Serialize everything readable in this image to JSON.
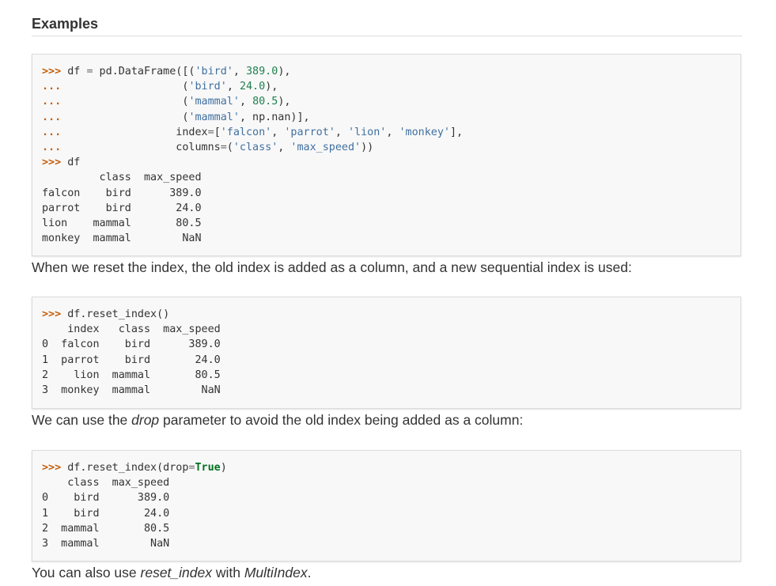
{
  "heading": "Examples",
  "block1": {
    "lines": [
      [
        [
          "prompt",
          ">>>"
        ],
        [
          "",
          " df "
        ],
        [
          "op",
          "="
        ],
        [
          "",
          " pd.DataFrame([("
        ],
        [
          "str",
          "'bird'"
        ],
        [
          "",
          ", "
        ],
        [
          "num",
          "389.0"
        ],
        [
          "",
          "),"
        ]
      ],
      [
        [
          "prompt",
          "..."
        ],
        [
          "",
          "                   ("
        ],
        [
          "str",
          "'bird'"
        ],
        [
          "",
          ", "
        ],
        [
          "num",
          "24.0"
        ],
        [
          "",
          "),"
        ]
      ],
      [
        [
          "prompt",
          "..."
        ],
        [
          "",
          "                   ("
        ],
        [
          "str",
          "'mammal'"
        ],
        [
          "",
          ", "
        ],
        [
          "num",
          "80.5"
        ],
        [
          "",
          "),"
        ]
      ],
      [
        [
          "prompt",
          "..."
        ],
        [
          "",
          "                   ("
        ],
        [
          "str",
          "'mammal'"
        ],
        [
          "",
          ", np.nan)],"
        ]
      ],
      [
        [
          "prompt",
          "..."
        ],
        [
          "",
          "                  index"
        ],
        [
          "op",
          "="
        ],
        [
          "",
          "["
        ],
        [
          "str",
          "'falcon'"
        ],
        [
          "",
          ", "
        ],
        [
          "str",
          "'parrot'"
        ],
        [
          "",
          ", "
        ],
        [
          "str",
          "'lion'"
        ],
        [
          "",
          ", "
        ],
        [
          "str",
          "'monkey'"
        ],
        [
          "",
          "],"
        ]
      ],
      [
        [
          "prompt",
          "..."
        ],
        [
          "",
          "                  columns"
        ],
        [
          "op",
          "="
        ],
        [
          "",
          "("
        ],
        [
          "str",
          "'class'"
        ],
        [
          "",
          ", "
        ],
        [
          "str",
          "'max_speed'"
        ],
        [
          "",
          "))"
        ]
      ],
      [
        [
          "prompt",
          ">>>"
        ],
        [
          "",
          " df"
        ]
      ],
      [
        [
          "",
          "         class  max_speed"
        ]
      ],
      [
        [
          "",
          "falcon    bird      389.0"
        ]
      ],
      [
        [
          "",
          "parrot    bird       24.0"
        ]
      ],
      [
        [
          "",
          "lion    mammal       80.5"
        ]
      ],
      [
        [
          "",
          "monkey  mammal        NaN"
        ]
      ]
    ]
  },
  "para1": "When we reset the index, the old index is added as a column, and a new sequential index is used:",
  "block2": {
    "lines": [
      [
        [
          "prompt",
          ">>>"
        ],
        [
          "",
          " df.reset_index()"
        ]
      ],
      [
        [
          "",
          "    index   class  max_speed"
        ]
      ],
      [
        [
          "",
          "0  falcon    bird      389.0"
        ]
      ],
      [
        [
          "",
          "1  parrot    bird       24.0"
        ]
      ],
      [
        [
          "",
          "2    lion  mammal       80.5"
        ]
      ],
      [
        [
          "",
          "3  monkey  mammal        NaN"
        ]
      ]
    ]
  },
  "para2": {
    "before": "We can use the ",
    "em": "drop",
    "after": " parameter to avoid the old index being added as a column:"
  },
  "block3": {
    "lines": [
      [
        [
          "prompt",
          ">>>"
        ],
        [
          "",
          " df.reset_index(drop"
        ],
        [
          "op",
          "="
        ],
        [
          "kw",
          "True"
        ],
        [
          "",
          ")"
        ]
      ],
      [
        [
          "",
          "    class  max_speed"
        ]
      ],
      [
        [
          "",
          "0    bird      389.0"
        ]
      ],
      [
        [
          "",
          "1    bird       24.0"
        ]
      ],
      [
        [
          "",
          "2  mammal       80.5"
        ]
      ],
      [
        [
          "",
          "3  mammal        NaN"
        ]
      ]
    ]
  },
  "para3": {
    "before": "You can also use ",
    "em1": "reset_index",
    "middle": " with ",
    "em2": "MultiIndex",
    "after": "."
  },
  "colors": {
    "prompt": "#c65d09",
    "string": "#4070a0",
    "number": "#208050",
    "keyword": "#007020",
    "code_background": "#f8f8f8"
  }
}
